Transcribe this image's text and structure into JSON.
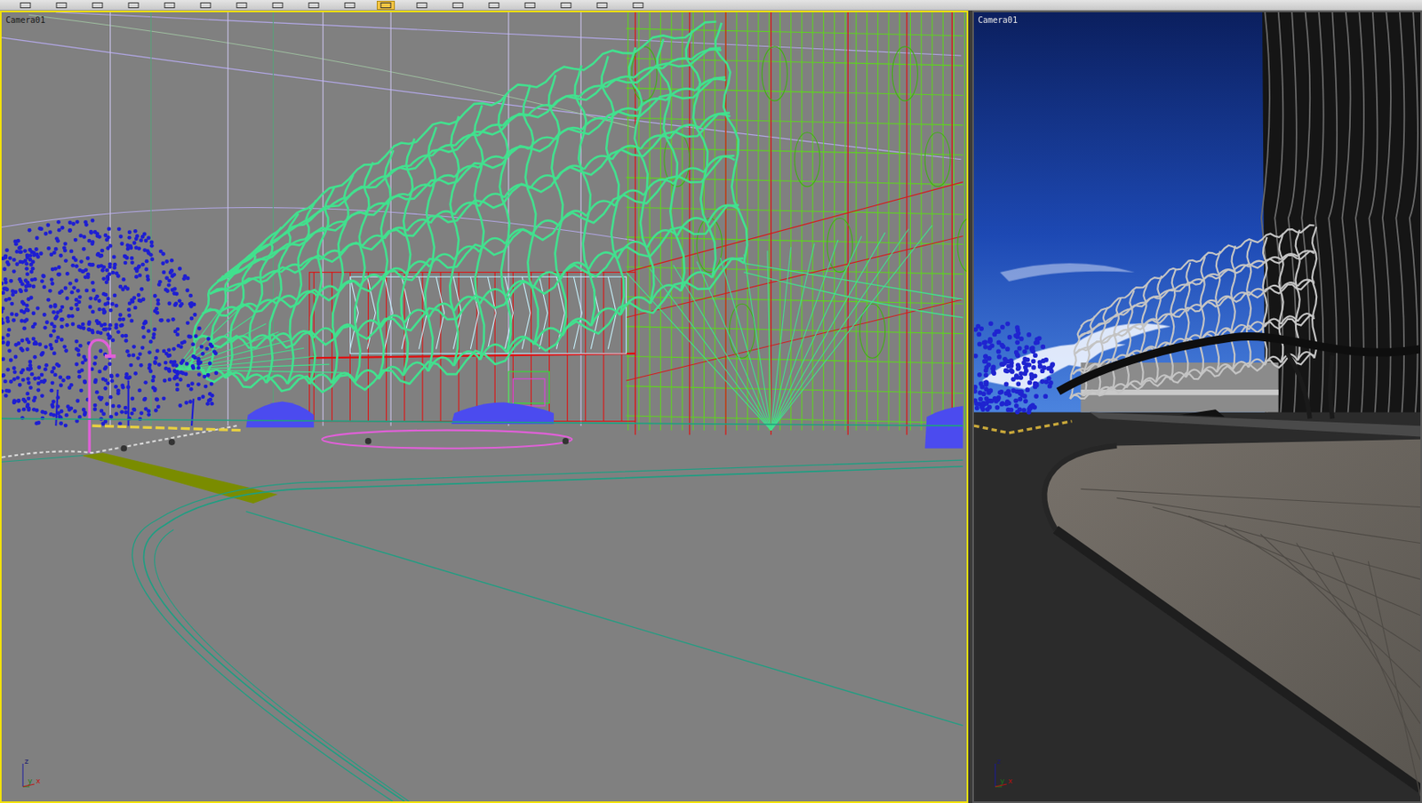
{
  "toolbar": {
    "buttons": [
      {
        "selected": false
      },
      {
        "selected": false
      },
      {
        "selected": false
      },
      {
        "selected": false
      },
      {
        "selected": false
      },
      {
        "selected": false
      },
      {
        "selected": false
      },
      {
        "selected": false
      },
      {
        "selected": false
      },
      {
        "selected": false
      },
      {
        "selected": true
      },
      {
        "selected": false
      },
      {
        "selected": false
      },
      {
        "selected": false
      },
      {
        "selected": false
      },
      {
        "selected": false
      },
      {
        "selected": false
      },
      {
        "selected": false
      }
    ]
  },
  "viewports": [
    {
      "label": "Camera01",
      "active": true,
      "kind": "wireframe",
      "axes": {
        "z": "z",
        "y": "y",
        "x": "x"
      }
    },
    {
      "label": "Camera01",
      "active": false,
      "kind": "render",
      "axes": {
        "z": "z",
        "y": "y",
        "x": "x"
      }
    }
  ]
}
